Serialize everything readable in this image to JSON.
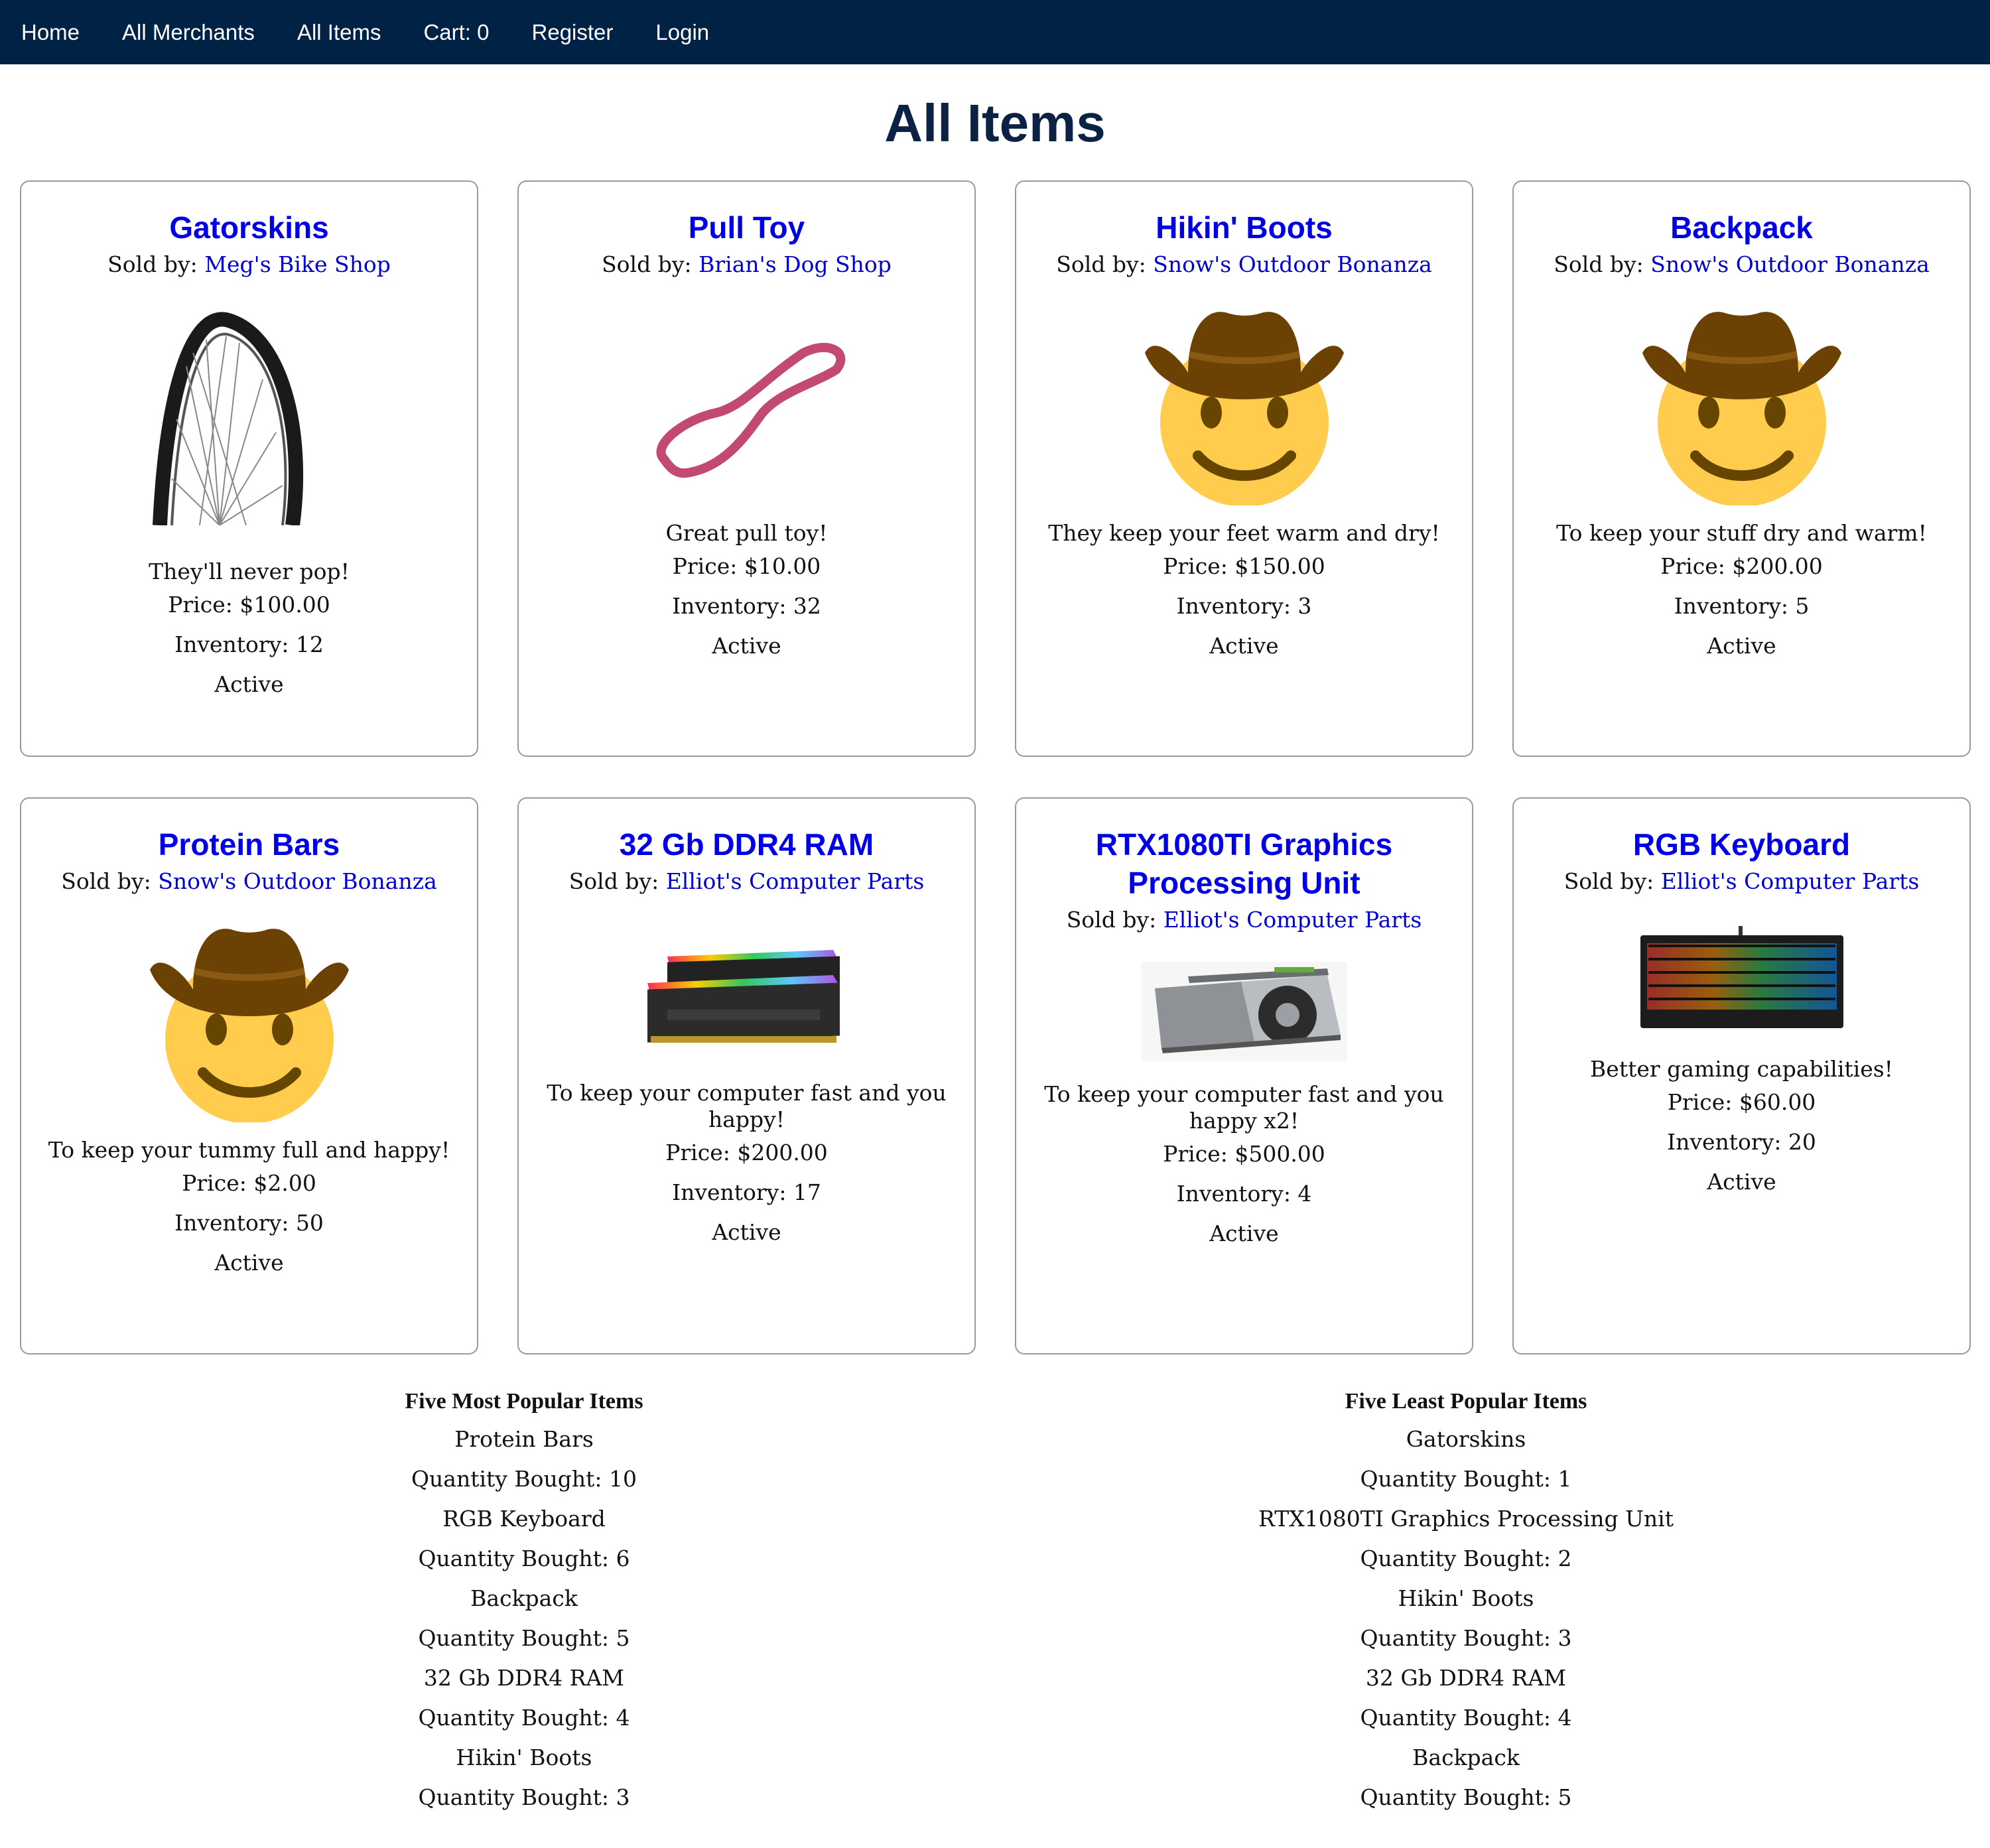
{
  "nav": [
    "Home",
    "All Merchants",
    "All Items",
    "Cart: 0",
    "Register",
    "Login"
  ],
  "title": "All Items",
  "sold_by_label": "Sold by:",
  "items": [
    {
      "name": "Gatorskins",
      "merchant": "Meg's Bike Shop",
      "description": "They'll never pop!",
      "price": "Price: $100.00",
      "inventory": "Inventory: 12",
      "status": "Active",
      "image": "bike-tire"
    },
    {
      "name": "Pull Toy",
      "merchant": "Brian's Dog Shop",
      "description": "Great pull toy!",
      "price": "Price: $10.00",
      "inventory": "Inventory: 32",
      "status": "Active",
      "image": "pull-toy"
    },
    {
      "name": "Hikin' Boots",
      "merchant": "Snow's Outdoor Bonanza",
      "description": "They keep your feet warm and dry!",
      "price": "Price: $150.00",
      "inventory": "Inventory: 3",
      "status": "Active",
      "image": "cowboy-emoji"
    },
    {
      "name": "Backpack",
      "merchant": "Snow's Outdoor Bonanza",
      "description": "To keep your stuff dry and warm!",
      "price": "Price: $200.00",
      "inventory": "Inventory: 5",
      "status": "Active",
      "image": "cowboy-emoji"
    },
    {
      "name": "Protein Bars",
      "merchant": "Snow's Outdoor Bonanza",
      "description": "To keep your tummy full and happy!",
      "price": "Price: $2.00",
      "inventory": "Inventory: 50",
      "status": "Active",
      "image": "cowboy-emoji"
    },
    {
      "name": "32 Gb DDR4 RAM",
      "merchant": "Elliot's Computer Parts",
      "description": "To keep your computer fast and you happy!",
      "price": "Price: $200.00",
      "inventory": "Inventory: 17",
      "status": "Active",
      "image": "ram-sticks"
    },
    {
      "name": "RTX1080TI Graphics Processing Unit",
      "merchant": "Elliot's Computer Parts",
      "description": "To keep your computer fast and you happy x2!",
      "price": "Price: $500.00",
      "inventory": "Inventory: 4",
      "status": "Active",
      "image": "graphics-card"
    },
    {
      "name": "RGB Keyboard",
      "merchant": "Elliot's Computer Parts",
      "description": "Better gaming capabilities!",
      "price": "Price: $60.00",
      "inventory": "Inventory: 20",
      "status": "Active",
      "image": "rgb-keyboard"
    }
  ],
  "most_popular": {
    "title": "Five Most Popular Items",
    "lines": [
      "Protein Bars",
      "Quantity Bought: 10",
      "RGB Keyboard",
      "Quantity Bought: 6",
      "Backpack",
      "Quantity Bought: 5",
      "32 Gb DDR4 RAM",
      "Quantity Bought: 4",
      "Hikin' Boots",
      "Quantity Bought: 3"
    ]
  },
  "least_popular": {
    "title": "Five Least Popular Items",
    "lines": [
      "Gatorskins",
      "Quantity Bought: 1",
      "RTX1080TI Graphics Processing Unit",
      "Quantity Bought: 2",
      "Hikin' Boots",
      "Quantity Bought: 3",
      "32 Gb DDR4 RAM",
      "Quantity Bought: 4",
      "Backpack",
      "Quantity Bought: 5"
    ]
  },
  "colors": {
    "navbar": "#002245",
    "link": "#0000e6",
    "title": "#0b2244"
  }
}
